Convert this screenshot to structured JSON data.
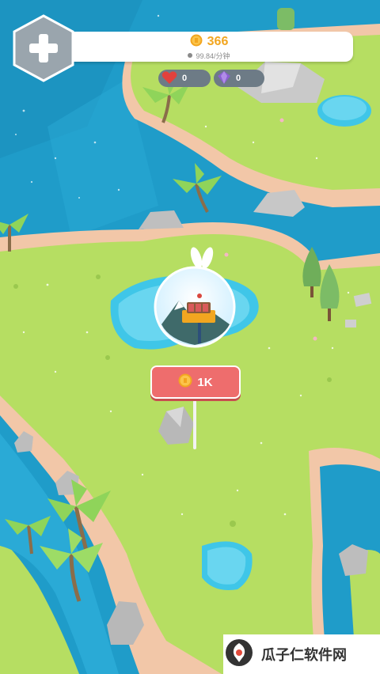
{
  "hud": {
    "coins": "366",
    "rate": "99.84/分钟",
    "hearts": "0",
    "gems": "0"
  },
  "shop": {
    "price": "1K"
  },
  "watermark": {
    "text": "瓜子仁软件网"
  },
  "icons": {
    "add": "plus-icon",
    "coin": "coin-icon",
    "heart": "heart-icon",
    "gem": "gem-icon"
  },
  "colors": {
    "ocean": "#1f9cc9",
    "grass": "#b6de62",
    "sand": "#f2c7a8",
    "coin": "#f2a620",
    "price_button": "#ee6d6d"
  }
}
